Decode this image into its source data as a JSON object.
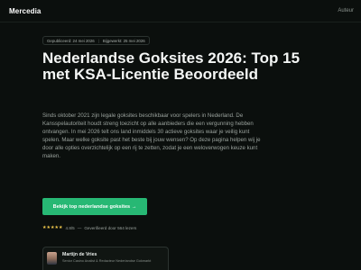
{
  "header": {
    "logo": "Mercedia",
    "nav_link": "Auteur"
  },
  "meta": {
    "published": "Gepubliceerd: 24 mei 2026",
    "separator": "|",
    "updated": "Bijgewerkt: 25 mei 2026"
  },
  "hero": {
    "title": "Nederlandse Goksites 2026: Top 15 met KSA-Licentie Beoordeeld",
    "intro": "Sinds oktober 2021 zijn legale goksites beschikbaar voor spelers in Nederland. De Kansspelautoriteit houdt streng toezicht op alle aanbieders die een vergunning hebben ontvangen. In mei 2026 telt ons land inmiddels 30 actieve goksites waar je veilig kunt spelen. Maar welke goksite past het beste bij jouw wensen? Op deze pagina helpen wij je door alle opties overzichtelijk op een rij te zetten, zodat je een weloverwogen keuze kunt maken.",
    "cta_label": "Bekijk top nederlandse goksites →"
  },
  "rating": {
    "stars": "★★★★★",
    "score": "4.8/5",
    "separator": "—",
    "reviewed_by": "Geverifieerd door 564 lezers"
  },
  "author": {
    "name": "Martijn de Vries",
    "role": "Senior Casino Analist & Redacteur Nederlandse Gokmarkt"
  },
  "colors": {
    "background": "#0b0f0d",
    "accent": "#27b874",
    "star": "#f2c94c"
  }
}
